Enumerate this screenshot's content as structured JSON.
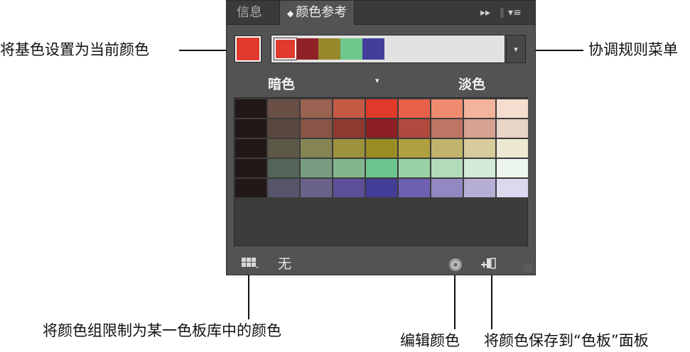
{
  "tabs": [
    {
      "label": "信息",
      "active": false
    },
    {
      "label": "颜色参考",
      "active": true
    }
  ],
  "tab_controls": {
    "collapse_glyph": "▸▸",
    "menu_glyph": "▾≡"
  },
  "base_color": "#e13a2e",
  "harmony_colors": [
    "#e13a2e",
    "#8f2127",
    "#97882c",
    "#6ec68c",
    "#423f99"
  ],
  "harmony_menu_glyph": "▾",
  "shade": {
    "dark_label": "暗色",
    "light_label": "淡色",
    "arrow": "▾"
  },
  "grid_rows": [
    [
      "#221817",
      "#6a4f46",
      "#9a6251",
      "#c45a44",
      "#e03a2a",
      "#e8604a",
      "#ef8c6f",
      "#f3b49c",
      "#f5ddd0"
    ],
    [
      "#221817",
      "#5b4640",
      "#8a5546",
      "#8e3a30",
      "#8d1f24",
      "#b04a3e",
      "#bf7564",
      "#d7a292",
      "#e9d4c8"
    ],
    [
      "#221817",
      "#5d5948",
      "#858453",
      "#9c913c",
      "#998c24",
      "#b0a040",
      "#c2b36c",
      "#d6cc9c",
      "#ece8d2"
    ],
    [
      "#221817",
      "#546458",
      "#789c80",
      "#82b68c",
      "#6bc58c",
      "#98d2a4",
      "#b3dbba",
      "#d3ead8",
      "#ecf5ee"
    ],
    [
      "#221817",
      "#58556a",
      "#6a6288",
      "#5e4f9a",
      "#443d98",
      "#6e60b0",
      "#9488c2",
      "#b7aed6",
      "#dcd8ee"
    ]
  ],
  "footer": {
    "limit_text": "无",
    "limit_icon": "swatch-library-icon",
    "edit_icon": "color-wheel-icon",
    "save_icon": "save-swatches-icon"
  },
  "callouts": {
    "set_base": "将基色设置为当前颜色",
    "harmony_menu": "协调规则菜单",
    "limit_group": "将颜色组限制为某一色板库中的颜色",
    "edit_color": "编辑颜色",
    "save_swatches": "将颜色保存到“色板”面板"
  }
}
